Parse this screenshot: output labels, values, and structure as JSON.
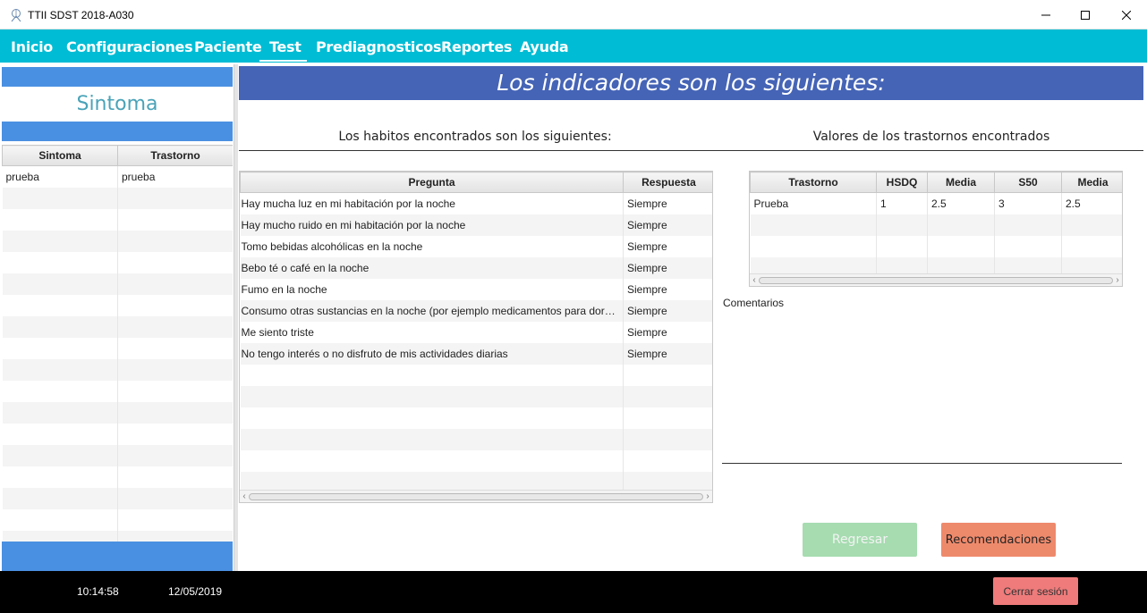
{
  "window": {
    "title": "TTII SDST 2018-A030",
    "icon": "app-logo-icon"
  },
  "menu": {
    "items": [
      "Inicio",
      "Configuraciones",
      "Paciente",
      "Test",
      "Prediagnosticos",
      "Reportes",
      "Ayuda"
    ],
    "active": "Test"
  },
  "left": {
    "heading": "Sintoma",
    "columns": [
      "Sintoma",
      "Trastorno"
    ],
    "rows": [
      [
        "prueba",
        "prueba"
      ]
    ]
  },
  "main": {
    "banner": "Los indicadores son los siguientes:",
    "habits_title": "Los habitos encontrados son los siguientes:",
    "values_title": "Valores de los trastornos encontrados",
    "habits": {
      "columns": [
        "Pregunta",
        "Respuesta"
      ],
      "rows": [
        [
          "Hay mucha luz en mi habitación por la noche",
          "Siempre"
        ],
        [
          "Hay mucho ruido en mi habitación por la noche",
          "Siempre"
        ],
        [
          "Tomo bebidas alcohólicas en la noche",
          "Siempre"
        ],
        [
          "Bebo té o café en la noche",
          "Siempre"
        ],
        [
          "Fumo en la noche",
          "Siempre"
        ],
        [
          "Consumo otras sustancias en la noche (por ejemplo medicamentos para dormir)",
          "Siempre"
        ],
        [
          "Me siento triste",
          "Siempre"
        ],
        [
          "No tengo interés o no disfruto de mis actividades diarias",
          "Siempre"
        ]
      ]
    },
    "values": {
      "columns": [
        "Trastorno",
        "HSDQ",
        "Media",
        "S50",
        "Media"
      ],
      "rows": [
        [
          "Prueba",
          "1",
          "2.5",
          "3",
          "2.5"
        ]
      ]
    },
    "comments_label": "Comentarios",
    "back_button": "Regresar",
    "recommendations_button": "Recomendaciones"
  },
  "status": {
    "time": "10:14:58",
    "date": "12/05/2019",
    "logout_button": "Cerrar sesión"
  },
  "colors": {
    "menubar": "#00bcd4",
    "banner": "#4564b6",
    "left_accent": "#4a90e2",
    "back_button": "#a6dcb0",
    "recommendations_button": "#ee8a6c",
    "logout_button": "#ef7b7b"
  }
}
